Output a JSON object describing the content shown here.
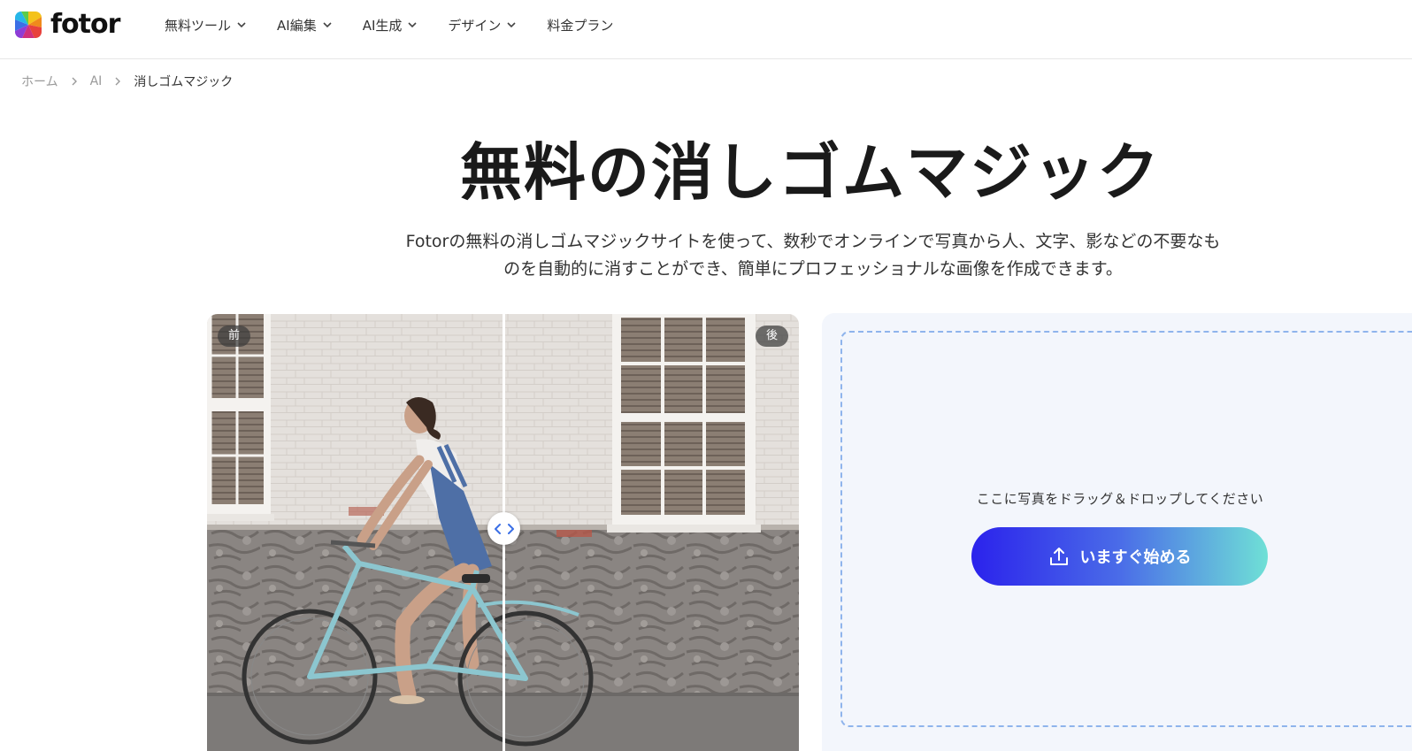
{
  "brand": {
    "name": "fotor"
  },
  "nav": {
    "items": [
      {
        "label": "無料ツール",
        "has_dropdown": true
      },
      {
        "label": "AI編集",
        "has_dropdown": true
      },
      {
        "label": "AI生成",
        "has_dropdown": true
      },
      {
        "label": "デザイン",
        "has_dropdown": true
      },
      {
        "label": "料金プラン",
        "has_dropdown": false
      }
    ]
  },
  "breadcrumb": {
    "items": [
      "ホーム",
      "AI",
      "消しゴムマジック"
    ]
  },
  "hero": {
    "title": "無料の消しゴムマジック",
    "description_line1": "Fotorの無料の消しゴムマジックサイトを使って、数秒でオンラインで写真から人、文字、影などの不要なも",
    "description_line2": "のを自動的に消すことができ、簡単にプロフェッショナルな画像を作成できます。"
  },
  "compare": {
    "before_label": "前",
    "after_label": "後",
    "slider_position": 0.5
  },
  "upload": {
    "drop_text": "ここに写真をドラッグ＆ドロップしてください",
    "button_label": "いますぐ始める",
    "button_icon": "upload-icon"
  },
  "colors": {
    "button_gradient_start": "#2b22ec",
    "button_gradient_end": "#6fe0d6",
    "dropzone_border": "#8fb4ec",
    "panel_bg": "#f3f6fc"
  }
}
